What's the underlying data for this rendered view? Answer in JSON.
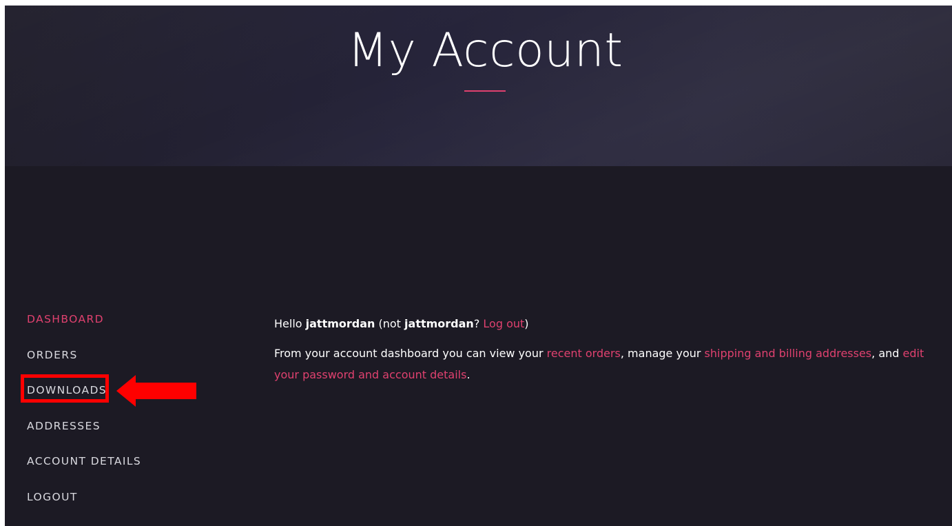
{
  "header": {
    "title": "My Account"
  },
  "nav": {
    "items": [
      {
        "label": "DASHBOARD",
        "active": true
      },
      {
        "label": "ORDERS"
      },
      {
        "label": "DOWNLOADS"
      },
      {
        "label": "ADDRESSES"
      },
      {
        "label": "ACCOUNT DETAILS"
      },
      {
        "label": "LOGOUT"
      }
    ]
  },
  "greeting": {
    "hello": "Hello ",
    "username": "jattmordan",
    "not_prefix": " (not ",
    "username_again": "jattmordan",
    "question": "? ",
    "logout_link": "Log out",
    "close_paren": ")"
  },
  "intro": {
    "part1": "From your account dashboard you can view your ",
    "link_orders": "recent orders",
    "part2": ", manage your ",
    "link_addresses": "shipping and billing addresses",
    "part3": ", and ",
    "link_account": "edit your password and account details",
    "part4": "."
  },
  "annotation": {
    "highlight_color": "#ff0000",
    "target": "DOWNLOADS"
  },
  "colors": {
    "accent": "#e0416f",
    "background": "#1c1a24",
    "hero": "#26243a",
    "text": "#ffffff",
    "nav_text": "#d9d9df"
  }
}
